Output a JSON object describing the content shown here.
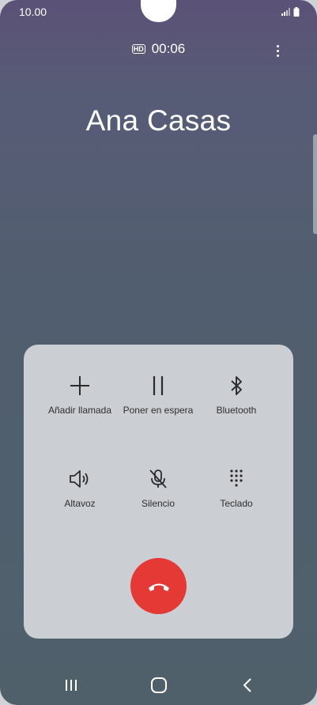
{
  "status_bar": {
    "time": "10.00"
  },
  "call": {
    "quality_badge": "HD",
    "duration": "00:06",
    "contact_name": "Ana Casas"
  },
  "controls": [
    {
      "label": "Añadir llamada",
      "icon": "plus-icon"
    },
    {
      "label": "Poner en espera",
      "icon": "pause-icon"
    },
    {
      "label": "Bluetooth",
      "icon": "bluetooth-icon"
    },
    {
      "label": "Altavoz",
      "icon": "speaker-icon"
    },
    {
      "label": "Silencio",
      "icon": "mic-off-icon"
    },
    {
      "label": "Teclado",
      "icon": "keypad-icon"
    }
  ],
  "end_call": {
    "icon": "end-call-icon",
    "color": "#e53935"
  },
  "navigation": {
    "icons": [
      "recents-icon",
      "home-icon",
      "back-icon"
    ]
  }
}
